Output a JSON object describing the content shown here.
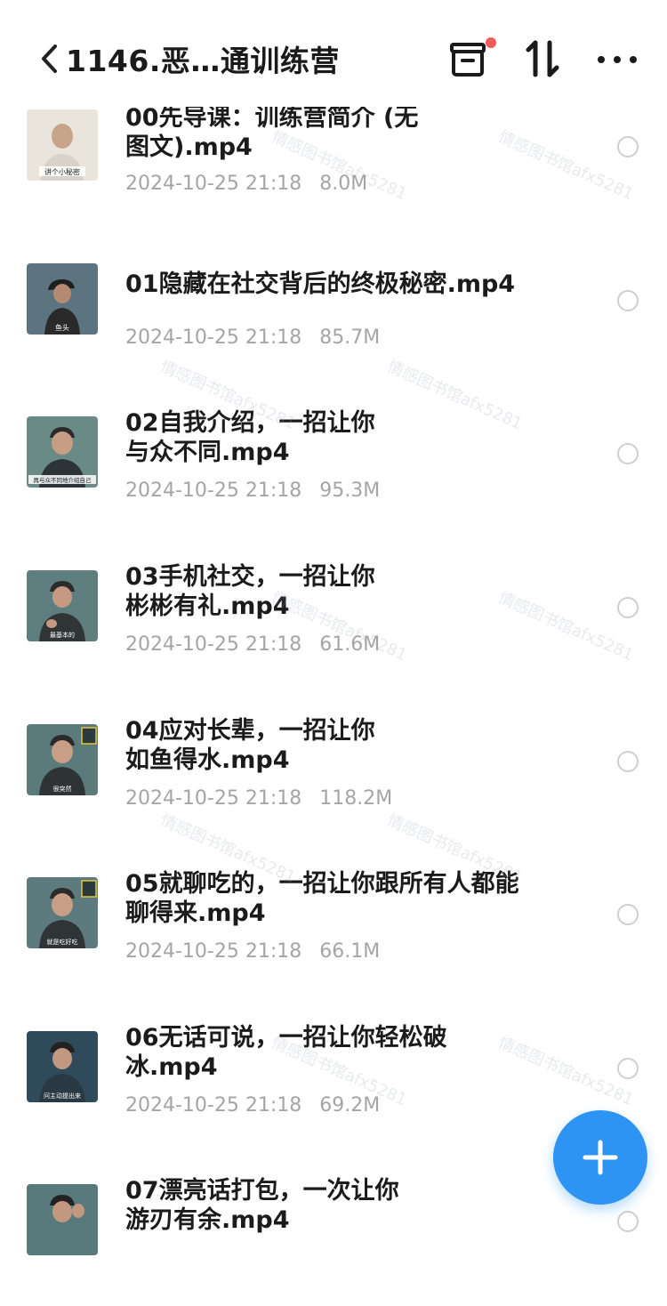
{
  "header": {
    "title": "1146.恶…通训练营",
    "back_icon": "chevron-left-icon",
    "box_icon": "archive-box-icon",
    "sort_icon": "sort-arrows-icon",
    "more_icon": "more-dots-icon",
    "notification_dot_color": "#f25a5a"
  },
  "files": [
    {
      "line1": "00先导课：训练营简介 (无",
      "line2": "图文).mp4",
      "date": "2024-10-25 21:18",
      "size": "8.0M",
      "thumb_caption": "讲个小秘密"
    },
    {
      "line1": "01隐藏在社交背后的终极秘密.mp4",
      "line2": "",
      "date": "2024-10-25 21:18",
      "size": "85.7M",
      "thumb_caption": "鱼头"
    },
    {
      "line1": "02自我介绍，一招让你",
      "line2": "与众不同.mp4",
      "date": "2024-10-25 21:18",
      "size": "95.3M",
      "thumb_caption": "再与众不同地介绍自己"
    },
    {
      "line1": "03手机社交，一招让你",
      "line2": "彬彬有礼.mp4",
      "date": "2024-10-25 21:18",
      "size": "61.6M",
      "thumb_caption": "最基本的"
    },
    {
      "line1": "04应对长辈，一招让你",
      "line2": "如鱼得水.mp4",
      "date": "2024-10-25 21:18",
      "size": "118.2M",
      "thumb_caption": "很突然"
    },
    {
      "line1": "05就聊吃的，一招让你跟所有人都能",
      "line2": "聊得来.mp4",
      "date": "2024-10-25 21:18",
      "size": "66.1M",
      "thumb_caption": "就是吃好吃"
    },
    {
      "line1": "06无话可说，一招让你轻松破",
      "line2": "冰.mp4",
      "date": "2024-10-25 21:18",
      "size": "69.2M",
      "thumb_caption": "问主动提出来"
    },
    {
      "line1": "07漂亮话打包，一次让你",
      "line2": "游刃有余.mp4",
      "date": "",
      "size": "",
      "thumb_caption": ""
    }
  ],
  "fab": {
    "icon": "plus-icon",
    "color": "#2d94f3"
  },
  "watermark": "情感图书馆afx5281"
}
